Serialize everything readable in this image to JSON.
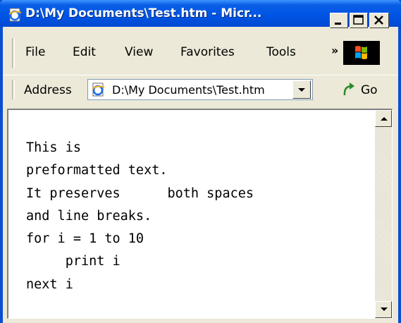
{
  "window": {
    "title": "D:\\My Documents\\Test.htm - Micr...",
    "colors": {
      "title_bar": "#0055e5",
      "chrome": "#ece9d8",
      "content_bg": "#ffffff"
    }
  },
  "menu": {
    "items": [
      "File",
      "Edit",
      "View",
      "Favorites",
      "Tools"
    ],
    "overflow_label": "»"
  },
  "address": {
    "label": "Address",
    "value": "D:\\My Documents\\Test.htm",
    "go_label": "Go"
  },
  "content": {
    "preformatted": "This is\npreformatted text.\nIt preserves      both spaces\nand line breaks.\nfor i = 1 to 10\n     print i\nnext i"
  },
  "icons": {
    "title": "ie-page-icon",
    "address": "ie-page-icon",
    "go": "go-arrow-icon",
    "throbber": "windows-logo-icon"
  }
}
